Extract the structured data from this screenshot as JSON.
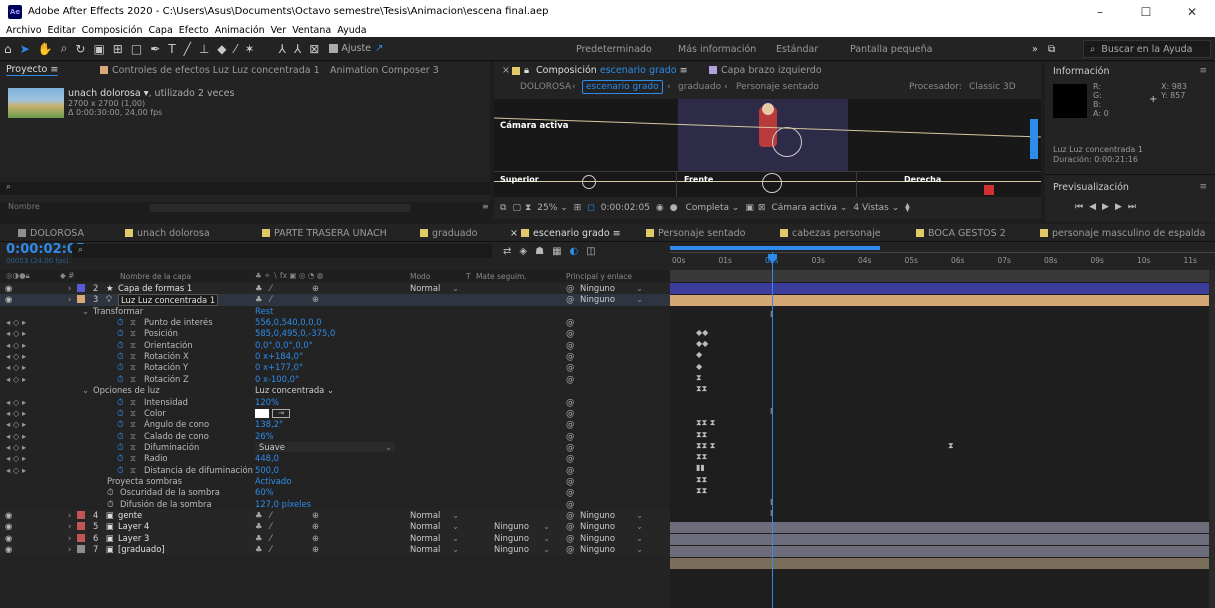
{
  "window": {
    "title": "Adobe After Effects 2020 - C:\\Users\\Asus\\Documents\\Octavo semestre\\Tesis\\Animacion\\escena final.aep",
    "logo": "Ae",
    "controls": [
      "–",
      "☐",
      "✕"
    ]
  },
  "menu": [
    "Archivo",
    "Editar",
    "Composición",
    "Capa",
    "Efecto",
    "Animación",
    "Ver",
    "Ventana",
    "Ayuda"
  ],
  "toolbar": {
    "snap_label": "Ajuste",
    "workspaces": [
      "Predeterminado",
      "Más información",
      "Estándar",
      "Pantalla pequeña"
    ],
    "more": "»",
    "help_placeholder": "Buscar en la Ayuda"
  },
  "project_panel": {
    "tabs": [
      "Proyecto",
      "Controles de efectos Luz Luz concentrada 1",
      "Animation Composer 3"
    ],
    "item_name": "unach dolorosa",
    "item_used": ", utilizado 2 veces",
    "item_size": "2700 x 2700 (1,00)",
    "item_duration": "Δ 0:00:30:00, 24,00 fps",
    "column_name": "Nombre",
    "search_icon": "search-icon"
  },
  "composition_panel": {
    "tab_label": "Composición",
    "tab_comp": "escenario grado",
    "layer_tab": "Capa brazo izquierdo",
    "breadcrumbs": [
      "DOLOROSA",
      "escenario grado",
      "graduado",
      "Personaje sentado"
    ],
    "renderer_label": "Procesador:",
    "renderer_value": "Classic 3D",
    "views": {
      "active_camera": "Cámara activa",
      "top": "Superior",
      "front": "Frente",
      "right": "Derecha"
    },
    "zoom": "25%",
    "timecode": "0:00:02:05",
    "resolution": "Completa",
    "camera": "Cámara activa",
    "view_layout": "4 Vistas"
  },
  "info_panel": {
    "title": "Información",
    "r": "R:",
    "g": "G:",
    "b": "B:",
    "a": "A:  0",
    "x": "X: 983",
    "y": "Y: 857",
    "layer": "Luz Luz concentrada 1",
    "duration": "Duración: 0:00:21:16",
    "preview_title": "Previsualización"
  },
  "timeline_tabs": [
    {
      "label": "DOLOROSA",
      "color": "#8f8f8f"
    },
    {
      "label": "unach dolorosa",
      "color": "#e0c96a"
    },
    {
      "label": "PARTE TRASERA UNACH",
      "color": "#e0c96a"
    },
    {
      "label": "graduado",
      "color": "#e0c96a"
    },
    {
      "label": "escenario grado",
      "color": "#e0c96a",
      "active": true
    },
    {
      "label": "Personaje sentado",
      "color": "#e0c96a"
    },
    {
      "label": "cabezas personaje",
      "color": "#e0c96a"
    },
    {
      "label": "BOCA GESTOS 2",
      "color": "#e0c96a"
    },
    {
      "label": "personaje masculino de espalda",
      "color": "#e0c96a"
    }
  ],
  "timeline": {
    "timecode": "0:00:02:05",
    "frame_info": "00053 (24.00 fps)",
    "headers": {
      "name": "Nombre de la capa",
      "mode": "Modo",
      "t": "T",
      "mate": "Mate seguim.",
      "parent": "Principal y enlace"
    },
    "ruler": [
      "00s",
      "01s",
      "02s",
      "03s",
      "04s",
      "05s",
      "06s",
      "07s",
      "08s",
      "09s",
      "10s",
      "11s"
    ],
    "layers_top": [
      {
        "num": "2",
        "name": "Capa de formas 1",
        "icon": "star-icon",
        "mode": "Normal",
        "parent": "Ninguno",
        "color": "#5b5bd6"
      },
      {
        "num": "3",
        "name": "Luz Luz concentrada 1",
        "icon": "light-icon",
        "mode": "",
        "parent": "Ninguno",
        "color": "#d8a878"
      }
    ],
    "transform": {
      "group": "Transformar",
      "reset": "Rest",
      "props": [
        {
          "name": "Punto de interés",
          "value": "556,0,540,0,0,0"
        },
        {
          "name": "Posición",
          "value": "585,0,495,0,-375,0"
        },
        {
          "name": "Orientación",
          "value": "0,0°,0,0°,0,0°"
        },
        {
          "name": "Rotación X",
          "value": "0 x+184,0°"
        },
        {
          "name": "Rotación Y",
          "value": "0 x+177,0°"
        },
        {
          "name": "Rotación Z",
          "value": "0 x-100,0°"
        }
      ]
    },
    "light": {
      "group": "Opciones de luz",
      "type": "Luz concentrada",
      "props": [
        {
          "name": "Intensidad",
          "value": "120%"
        },
        {
          "name": "Color",
          "value": ""
        },
        {
          "name": "Ángulo de cono",
          "value": "138,2°"
        },
        {
          "name": "Calado de cono",
          "value": "26%"
        },
        {
          "name": "Difuminación",
          "value": "Suave"
        },
        {
          "name": "Radio",
          "value": "448,0"
        },
        {
          "name": "Distancia de difuminación",
          "value": "500,0"
        }
      ],
      "shadow_props": [
        {
          "name": "Proyecta sombras",
          "value": "Activado"
        },
        {
          "name": "Oscuridad de la sombra",
          "value": "60%"
        },
        {
          "name": "Difusión de la sombra",
          "value": "127,0 píxeles"
        }
      ]
    },
    "layers_bottom": [
      {
        "num": "4",
        "name": "gente",
        "mode": "Normal",
        "mate": "",
        "parent": "Ninguno",
        "color": "#c15454"
      },
      {
        "num": "5",
        "name": "Layer 4",
        "mode": "Normal",
        "mate": "Ninguno",
        "parent": "Ninguno",
        "color": "#c15454"
      },
      {
        "num": "6",
        "name": "Layer 3",
        "mode": "Normal",
        "mate": "Ninguno",
        "parent": "Ninguno",
        "color": "#c15454"
      },
      {
        "num": "7",
        "name": "[graduado]",
        "mode": "Normal",
        "mate": "Ninguno",
        "parent": "Ninguno",
        "color": "#8f8f8f"
      }
    ]
  }
}
